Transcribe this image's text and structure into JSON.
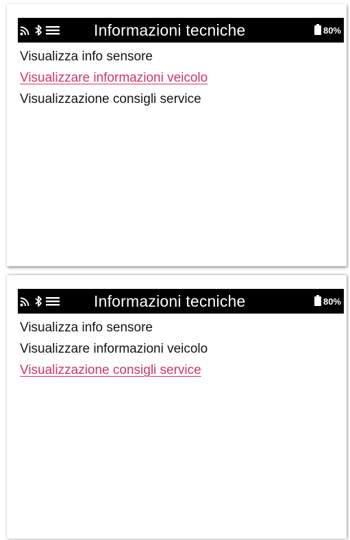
{
  "accent_color": "#d1346a",
  "icons": [
    "rfid-signal-icon",
    "bluetooth-icon",
    "hamburger-menu-icon",
    "battery-icon"
  ],
  "screens": [
    {
      "title": "Informazioni tecniche",
      "battery": "80%",
      "items": [
        {
          "label": "Visualizza info sensore",
          "selected": false
        },
        {
          "label": "Visualizzare informazioni veicolo",
          "selected": true
        },
        {
          "label": "Visualizzazione consigli service",
          "selected": false
        }
      ]
    },
    {
      "title": "Informazioni tecniche",
      "battery": "80%",
      "items": [
        {
          "label": "Visualizza info sensore",
          "selected": false
        },
        {
          "label": "Visualizzare informazioni veicolo",
          "selected": false
        },
        {
          "label": "Visualizzazione consigli service",
          "selected": true
        }
      ]
    }
  ]
}
